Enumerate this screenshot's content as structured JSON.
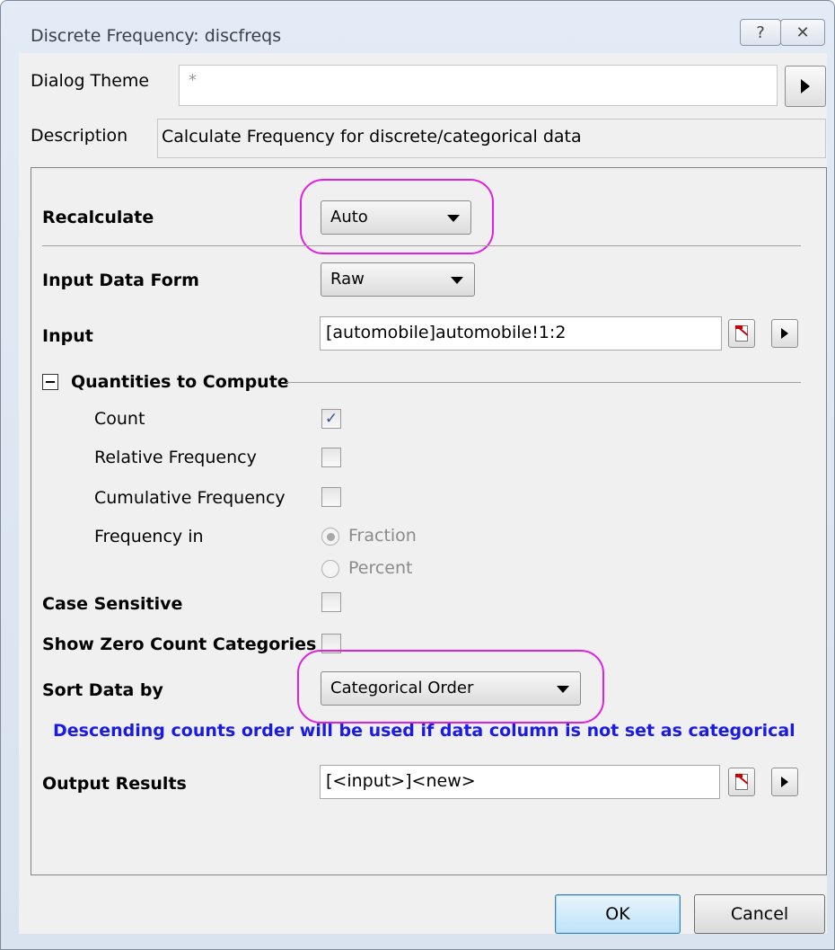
{
  "window": {
    "title": "Discrete Frequency: discfreqs",
    "help_glyph": "?",
    "close_glyph": "✕"
  },
  "theme": {
    "label": "Dialog Theme",
    "value": "*"
  },
  "description": {
    "label": "Description",
    "value": "Calculate Frequency for discrete/categorical data"
  },
  "recalculate": {
    "label": "Recalculate",
    "selected": "Auto"
  },
  "input_data_form": {
    "label": "Input Data Form",
    "selected": "Raw"
  },
  "input": {
    "label": "Input",
    "value": "[automobile]automobile!1:2"
  },
  "quantities": {
    "section_label": "Quantities to Compute",
    "count": {
      "label": "Count",
      "checked": true,
      "check_glyph": "✓"
    },
    "relative": {
      "label": "Relative Frequency",
      "checked": false
    },
    "cumulative": {
      "label": "Cumulative Frequency",
      "checked": false
    },
    "frequency_in": {
      "label": "Frequency in",
      "options": [
        "Fraction",
        "Percent"
      ],
      "selected": "Fraction"
    }
  },
  "case_sensitive": {
    "label": "Case Sensitive",
    "checked": false
  },
  "show_zero": {
    "label": "Show Zero Count Categories",
    "checked": false
  },
  "sort_data": {
    "label": "Sort Data by",
    "selected": "Categorical Order"
  },
  "note": "Descending counts order will be used if data column is not set as categorical",
  "output": {
    "label": "Output Results",
    "value": "[<input>]<new>"
  },
  "buttons": {
    "ok": "OK",
    "cancel": "Cancel"
  },
  "colors": {
    "highlight": "#e020e0",
    "note": "#1a1ae8"
  }
}
